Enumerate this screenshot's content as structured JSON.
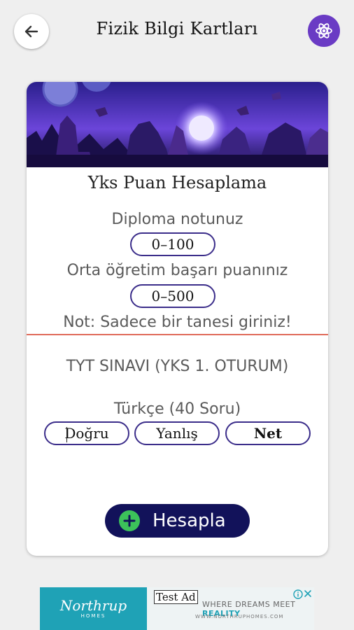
{
  "app": {
    "title": "Fizik Bilgi Kartları"
  },
  "calculator": {
    "title": "Yks Puan Hesaplama",
    "diploma_label": "Diploma notunuz",
    "diploma_placeholder": "0–100",
    "obp_label": "Orta öğretim başarı puanınız",
    "obp_placeholder": "0–500",
    "note": "Not: Sadece bir tanesi giriniz!",
    "exam_title": "TYT SINAVI (YKS 1. OTURUM)",
    "subject_label": "Türkçe (40 Soru)",
    "correct_placeholder": "Doğru",
    "wrong_placeholder": "Yanlış",
    "net_label": "Net",
    "calculate_button": "Hesapla"
  },
  "ad": {
    "badge": "Test Ad",
    "brand": "Northrup",
    "brand_sub": "HOMES",
    "tagline_prefix": "WHERE DREAMS MEET",
    "tagline_highlight": "REALITY",
    "url": "WWW.NORTHRUPHOMES.COM"
  },
  "colors": {
    "accent": "#6a3bc4",
    "button": "#12125a",
    "plus": "#3cc25a",
    "divider": "#e06a5a",
    "pill_border": "#3b2d8a"
  },
  "icons": {
    "back": "arrow-left-icon",
    "atom": "atom-icon",
    "plus": "plus-icon",
    "info": "info-icon",
    "close": "close-icon"
  }
}
